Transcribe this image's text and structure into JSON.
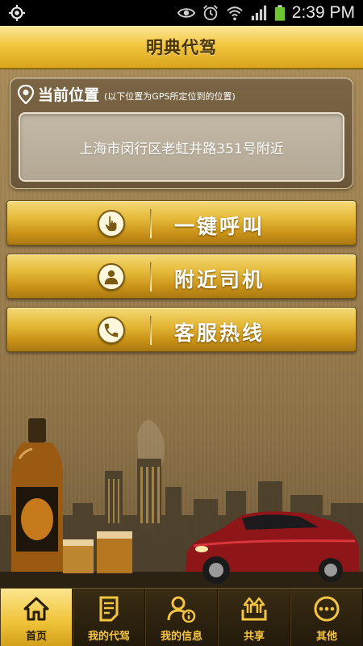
{
  "status_bar": {
    "time": "2:39 PM"
  },
  "header": {
    "title": "明典代驾"
  },
  "location": {
    "title": "当前位置",
    "note": "(以下位置为GPS所定位到的位置)",
    "address": "上海市闵行区老虹井路351号附近"
  },
  "actions": [
    {
      "label": "一键呼叫",
      "icon": "hand-tap-icon"
    },
    {
      "label": "附近司机",
      "icon": "driver-person-icon"
    },
    {
      "label": "客服热线",
      "icon": "phone-icon"
    }
  ],
  "bottom_nav": [
    {
      "label": "首页",
      "icon": "home-icon",
      "active": true
    },
    {
      "label": "我的代驾",
      "icon": "document-icon",
      "active": false
    },
    {
      "label": "我的信息",
      "icon": "user-info-icon",
      "active": false
    },
    {
      "label": "共享",
      "icon": "share-icon",
      "active": false
    },
    {
      "label": "其他",
      "icon": "more-icon",
      "active": false
    }
  ],
  "colors": {
    "accent_gold": "#f0c53c",
    "nav_background": "#2a2010",
    "main_background": "#9c7f4f"
  }
}
